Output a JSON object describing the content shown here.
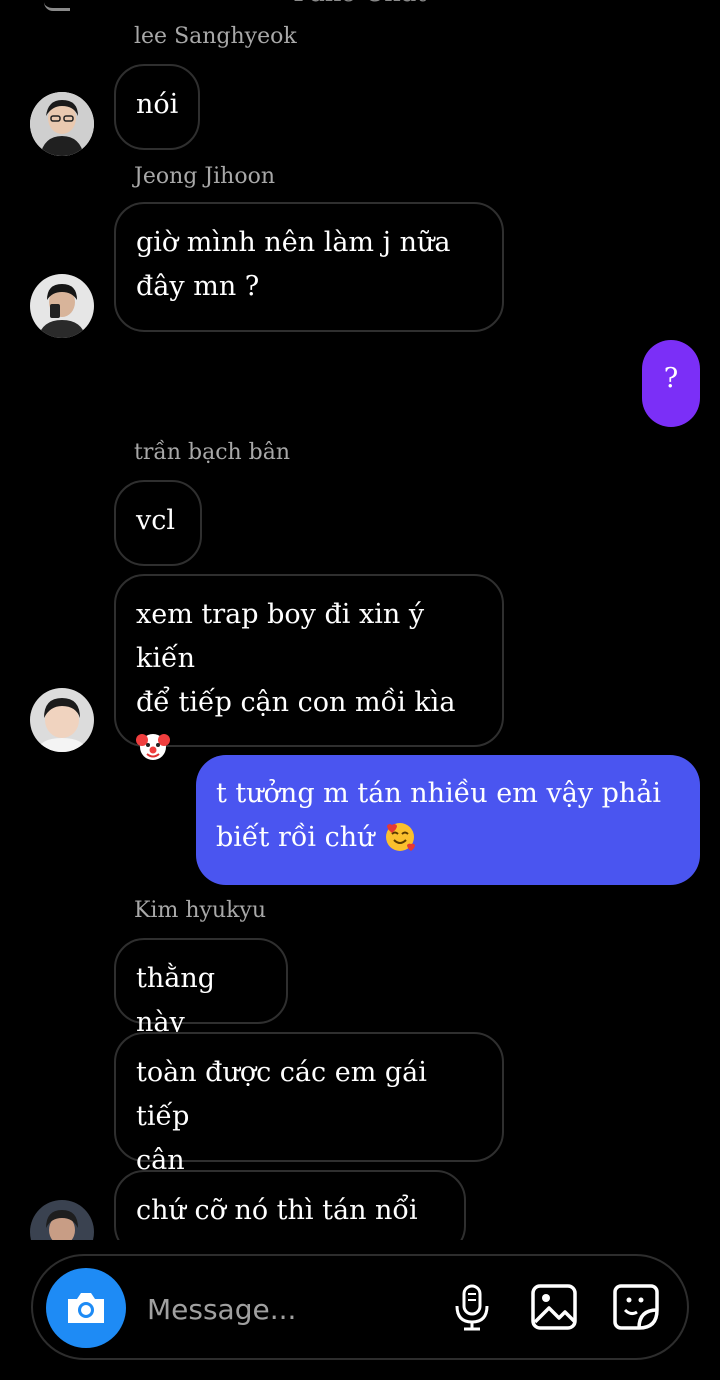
{
  "header": {
    "title": "Fake Chat"
  },
  "colors": {
    "background": "#000000",
    "incoming_bubble_border": "#2f2f2f",
    "outgoing_purple": "#7b2ff7",
    "outgoing_blue": "#4a55f0",
    "camera_button": "#1e8bf5"
  },
  "messages": [
    {
      "sender": "lee Sanghyeok",
      "bubbles": [
        {
          "text": "nói"
        }
      ]
    },
    {
      "sender": "Jeong Jihoon",
      "bubbles": [
        {
          "line1": "giờ mình nên làm j nữa",
          "line2": "đây mn ?"
        }
      ]
    },
    {
      "outgoing": true,
      "bubbles": [
        {
          "text": "?"
        }
      ]
    },
    {
      "sender": "trần bạch bân",
      "bubbles": [
        {
          "text": "vcl"
        },
        {
          "line1": "xem trap boy đi xin ý kiến",
          "line2": "để tiếp cận con mồi kìa",
          "emoji": "clown-face"
        }
      ]
    },
    {
      "outgoing": true,
      "bubbles": [
        {
          "line1": "t tưởng m tán nhiều em vậy phải",
          "line2": "biết rồi chứ",
          "emoji": "smiling-face-with-hearts"
        }
      ]
    },
    {
      "sender": "Kim hyukyu",
      "bubbles": [
        {
          "text": "thằng này"
        },
        {
          "line1": "toàn được các em gái tiếp",
          "line2": "cận"
        },
        {
          "text": "chứ cỡ nó thì tán nổi ai"
        }
      ]
    }
  ],
  "composer": {
    "placeholder": "Message...",
    "icons": [
      "camera-icon",
      "microphone-icon",
      "gallery-icon",
      "sticker-icon"
    ]
  }
}
